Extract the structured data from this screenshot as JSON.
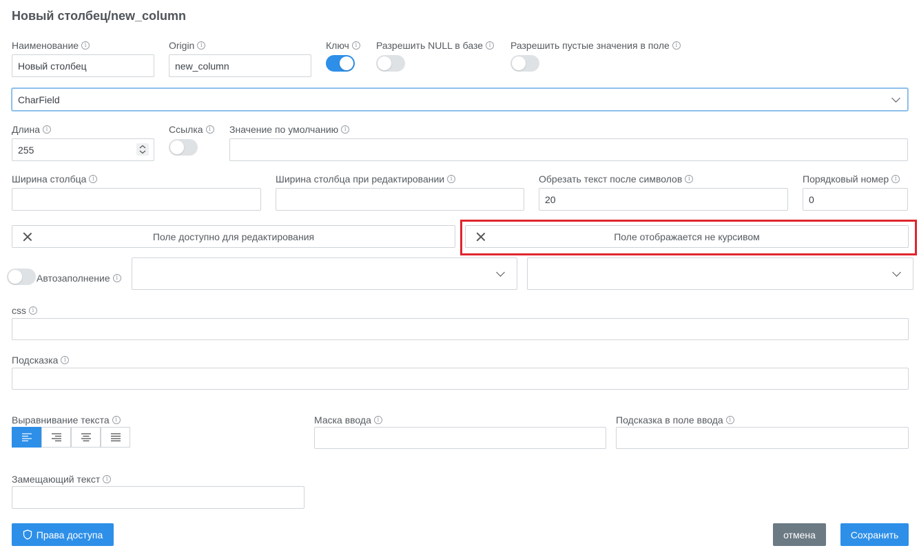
{
  "title": "Новый столбец/new_column",
  "name": {
    "label": "Наименование",
    "value": "Новый столбец"
  },
  "origin": {
    "label": "Origin",
    "value": "new_column"
  },
  "key": {
    "label": "Ключ",
    "on": true
  },
  "allow_null": {
    "label": "Разрешить NULL в базе",
    "on": false
  },
  "allow_empty": {
    "label": "Разрешить пустые значения в поле",
    "on": false
  },
  "field_type": {
    "value": "CharField"
  },
  "length": {
    "label": "Длина",
    "value": "255"
  },
  "link": {
    "label": "Ссылка",
    "on": false
  },
  "default_value": {
    "label": "Значение по умолчанию",
    "value": ""
  },
  "column_width": {
    "label": "Ширина столбца",
    "value": ""
  },
  "edit_column_width": {
    "label": "Ширина столбца при редактировании",
    "value": ""
  },
  "truncate": {
    "label": "Обрезать текст после символов",
    "value": "20"
  },
  "order": {
    "label": "Порядковый номер",
    "value": "0"
  },
  "editable_toggle": {
    "label": "Поле доступно для редактирования"
  },
  "italic_toggle": {
    "label": "Поле отображается не курсивом"
  },
  "autofill": {
    "label": "Автозаполнение",
    "on": false
  },
  "css": {
    "label": "css",
    "value": ""
  },
  "hint": {
    "label": "Подсказка",
    "value": ""
  },
  "text_align": {
    "label": "Выравнивание текста",
    "options": [
      "left",
      "right",
      "center",
      "justify"
    ],
    "selected": "left"
  },
  "input_mask": {
    "label": "Маска ввода",
    "value": ""
  },
  "placeholder_hint": {
    "label": "Подсказка в поле ввода",
    "value": ""
  },
  "replace_text": {
    "label": "Замещающий текст",
    "value": ""
  },
  "buttons": {
    "access": "Права доступа",
    "cancel": "отмена",
    "save": "Сохранить"
  },
  "colors": {
    "primary": "#2d8fe8",
    "cancel": "#6c7a84",
    "highlight": "#e0242c"
  }
}
